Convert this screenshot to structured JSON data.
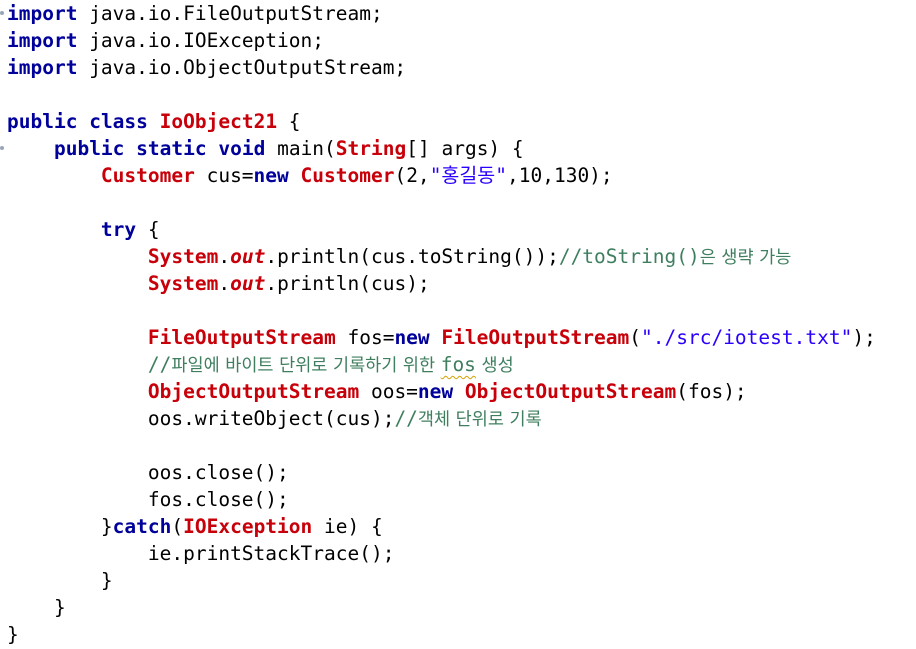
{
  "code": {
    "l1_kw": "import",
    "l1_rest": " java.io.FileOutputStream;",
    "l2_kw": "import",
    "l2_rest": " java.io.IOException;",
    "l3_kw": "import",
    "l3_rest": " java.io.ObjectOutputStream;",
    "l5_kw1": "public",
    "l5_kw2": "class",
    "l5_name": "IoObject21",
    "l5_brace": " {",
    "l6_indent": "    ",
    "l6_kw1": "public",
    "l6_kw2": "static",
    "l6_kw3": "void",
    "l6_main": " main(",
    "l6_type": "String",
    "l6_rest": "[] args) {",
    "l7_indent": "        ",
    "l7_type1": "Customer",
    "l7_mid": " cus=",
    "l7_kw": "new",
    "l7_type2": "Customer",
    "l7_args1": "(2,",
    "l7_str": "\"홍길동\"",
    "l7_args2": ",10,130);",
    "l9_indent": "        ",
    "l9_kw": "try",
    "l9_rest": " {",
    "l10_indent": "            ",
    "l10_sys": "System",
    "l10_dot": ".",
    "l10_out": "out",
    "l10_call": ".println(cus.toString());",
    "l10_cm_code": "//toString()",
    "l10_cm_ko": "은 생략 가능",
    "l11_indent": "            ",
    "l11_sys": "System",
    "l11_dot": ".",
    "l11_out": "out",
    "l11_call": ".println(cus);",
    "l13_indent": "            ",
    "l13_type1": "FileOutputStream",
    "l13_mid": " fos=",
    "l13_kw": "new",
    "l13_type2": "FileOutputStream",
    "l13_open": "(",
    "l13_str": "\"./src/iotest.txt\"",
    "l13_close": ");",
    "l14_indent": "            ",
    "l14_cm_slash": "//",
    "l14_cm_ko": "파일에 바이트 단위로 기록하기 위한 ",
    "l14_cm_fos": "fos",
    "l14_cm_ko2": " 생성",
    "l15_indent": "            ",
    "l15_type1": "ObjectOutputStream",
    "l15_mid": " oos=",
    "l15_kw": "new",
    "l15_type2": "ObjectOutputStream",
    "l15_rest": "(fos);",
    "l16_indent": "            ",
    "l16_call": "oos.writeObject(cus);",
    "l16_cm_slash": "//",
    "l16_cm_ko": "객체 단위로 기록",
    "l18_indent": "            ",
    "l18_call": "oos.close();",
    "l19_indent": "            ",
    "l19_call": "fos.close();",
    "l20_indent": "        ",
    "l20_open": "}",
    "l20_kw": "catch",
    "l20_paren": "(",
    "l20_type": "IOException",
    "l20_rest": " ie) {",
    "l21_indent": "            ",
    "l21_call": "ie.printStackTrace();",
    "l22_indent": "        ",
    "l22_brace": "}",
    "l23_indent": "    ",
    "l23_brace": "}",
    "l24_brace": "}"
  },
  "colors": {
    "keyword": "#00009a",
    "type": "#c8000a",
    "string": "#2a00ff",
    "comment": "#3f7f5f",
    "plain": "#000000",
    "background": "#ffffff"
  }
}
